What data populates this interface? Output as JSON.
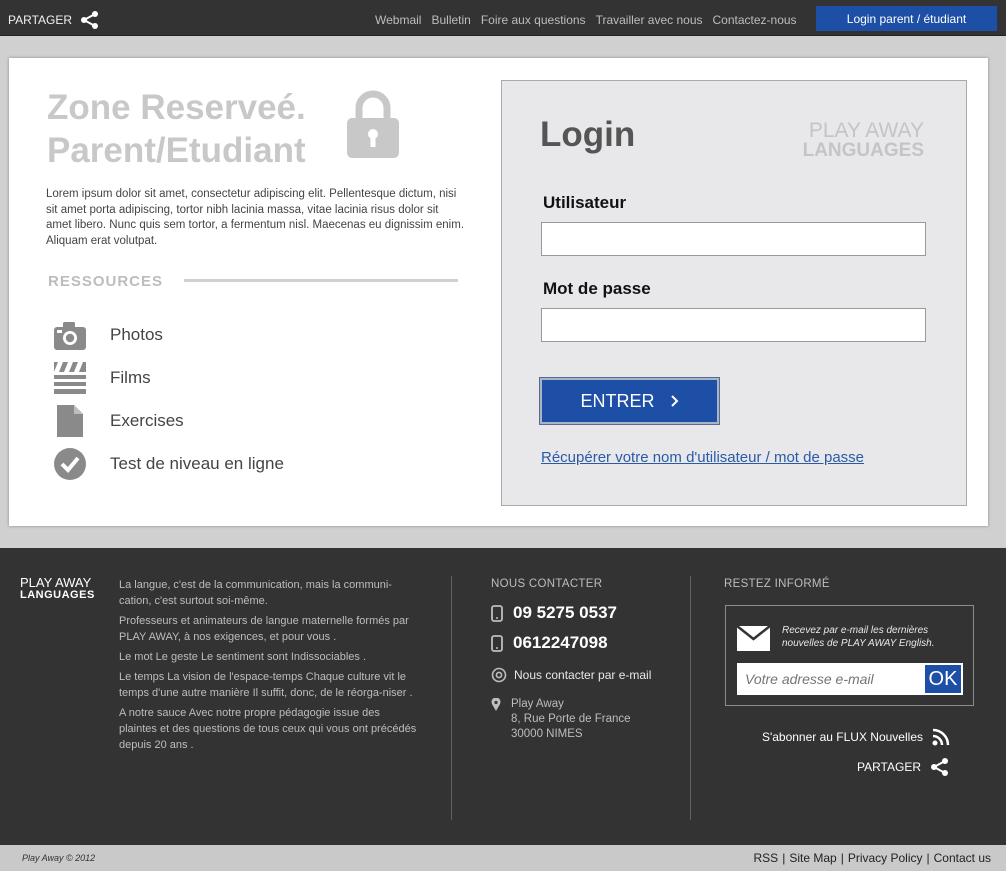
{
  "topbar": {
    "share_label": "PARTAGER",
    "nav": [
      "Webmail",
      "Bulletin",
      "Foire aux questions",
      "Travailler avec nous",
      "Contactez-nous"
    ],
    "login_button": "Login parent / étudiant"
  },
  "zone": {
    "title_line1": "Zone Reserveé.",
    "title_line2": "Parent/Etudiant",
    "intro": "Lorem ipsum dolor sit amet, consectetur adipiscing elit. Pellentesque dictum, nisi sit amet porta adipiscing, tortor nibh lacinia massa, vitae lacinia risus dolor sit amet libero. Nunc quis sem tortor, a fermentum nisl. Maecenas eu dignissim enim. Aliquam erat volutpat."
  },
  "resources": {
    "heading": "RESSOURCES",
    "items": [
      {
        "label": "Photos",
        "icon": "camera-icon"
      },
      {
        "label": "Films",
        "icon": "clapperboard-icon"
      },
      {
        "label": "Exercises",
        "icon": "document-icon"
      },
      {
        "label": "Test de niveau en ligne",
        "icon": "checkmark-icon"
      }
    ]
  },
  "login": {
    "title": "Login",
    "brand_line1": "PLAY AWAY",
    "brand_line2": "LANGUAGES",
    "username_label": "Utilisateur",
    "username_value": "",
    "password_label": "Mot de passe",
    "password_value": "",
    "enter_label": "ENTRER",
    "recover_label": "Récupérer votre nom d'utilisateur /  mot de passe"
  },
  "footer": {
    "brand_line1": "PLAY AWAY",
    "brand_line2": "LANGUAGES",
    "about": [
      "La langue, c'est de la communication, mais la communi-cation, c'est surtout soi-même.",
      "Professeurs et animateurs de langue maternelle formés par PLAY AWAY, à nos exigences, et pour vous .",
      "Le mot Le geste Le sentiment sont Indissociables .",
      "Le temps La vision de l'espace-temps Chaque culture vit le temps d'une autre manière Il suffit, donc, de le réorga-niser .",
      "A notre sauce Avec notre propre pédagogie issue des plaintes et des questions de tous ceux qui vous ont précédés depuis 20 ans ."
    ],
    "contact_heading": "NOUS CONTACTER",
    "phone1": "09 5275 0537",
    "phone2": "0612247098",
    "email_link": "Nous contacter par e-mail",
    "address_line1": "Play Away",
    "address_line2": "8, Rue Porte de France",
    "address_line3": "30000 NIMES",
    "inform_heading": "RESTEZ INFORMÉ",
    "newsletter_text": "Recevez par e-mail les dernières nouvelles de PLAY AWAY English.",
    "email_placeholder": "Votre adresse e-mail",
    "ok_label": "OK",
    "rss_label": "S'abonner au FLUX Nouvelles",
    "share_label": "PARTAGER"
  },
  "bottombar": {
    "copyright": "Play Away © 2012",
    "links": [
      "RSS",
      "Site Map",
      "Privacy Policy",
      "Contact us"
    ],
    "separator": "|"
  },
  "colors": {
    "accent": "#1e4fa6",
    "dark_bg": "#333333",
    "light_gray_text": "#c8c8c8"
  }
}
